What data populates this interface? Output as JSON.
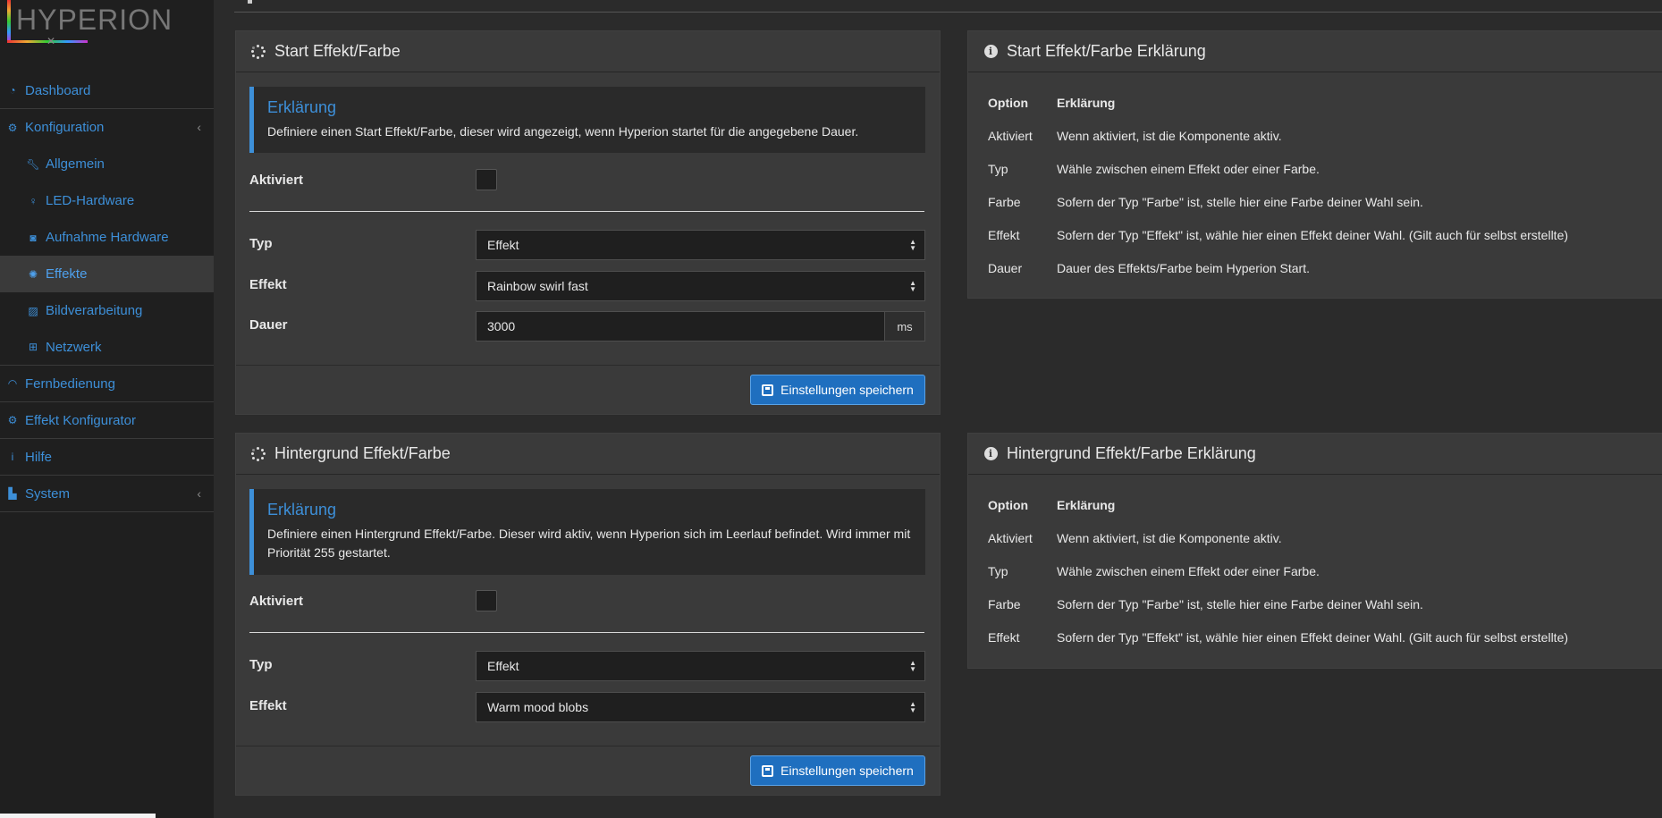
{
  "app": {
    "logo_text": "HYPERION"
  },
  "sidebar": {
    "items": [
      {
        "label": "Dashboard",
        "icon": "dashboard-icon"
      },
      {
        "label": "Konfiguration",
        "icon": "gear-icon",
        "expanded": true
      },
      {
        "label": "Allgemein",
        "icon": "wrench-icon"
      },
      {
        "label": "LED-Hardware",
        "icon": "lightbulb-icon"
      },
      {
        "label": "Aufnahme Hardware",
        "icon": "camera-icon"
      },
      {
        "label": "Effekte",
        "icon": "spinner-icon",
        "active": true
      },
      {
        "label": "Bildverarbeitung",
        "icon": "image-icon"
      },
      {
        "label": "Netzwerk",
        "icon": "network-icon"
      },
      {
        "label": "Fernbedienung",
        "icon": "wifi-icon"
      },
      {
        "label": "Effekt Konfigurator",
        "icon": "gears-icon"
      },
      {
        "label": "Hilfe",
        "icon": "info-icon"
      },
      {
        "label": "System",
        "icon": "chart-icon"
      }
    ]
  },
  "start_panel": {
    "title": "Start Effekt/Farbe",
    "callout_title": "Erklärung",
    "callout_text": "Definiere einen Start Effekt/Farbe, dieser wird angezeigt, wenn Hyperion startet für die angegebene Dauer.",
    "aktiviert_label": "Aktiviert",
    "aktiviert_checked": false,
    "typ_label": "Typ",
    "typ_value": "Effekt",
    "effekt_label": "Effekt",
    "effekt_value": "Rainbow swirl fast",
    "dauer_label": "Dauer",
    "dauer_value": "3000",
    "dauer_unit": "ms",
    "save_label": "Einstellungen speichern"
  },
  "start_explain": {
    "title": "Start Effekt/Farbe Erklärung",
    "header": {
      "option": "Option",
      "explanation": "Erklärung"
    },
    "rows": [
      {
        "option": "Aktiviert",
        "text": "Wenn aktiviert, ist die Komponente aktiv."
      },
      {
        "option": "Typ",
        "text": "Wähle zwischen einem Effekt oder einer Farbe."
      },
      {
        "option": "Farbe",
        "text": "Sofern der Typ \"Farbe\" ist, stelle hier eine Farbe deiner Wahl sein."
      },
      {
        "option": "Effekt",
        "text": "Sofern der Typ \"Effekt\" ist, wähle hier einen Effekt deiner Wahl. (Gilt auch für selbst erstellte)"
      },
      {
        "option": "Dauer",
        "text": "Dauer des Effekts/Farbe beim Hyperion Start."
      }
    ]
  },
  "bg_panel": {
    "title": "Hintergrund Effekt/Farbe",
    "callout_title": "Erklärung",
    "callout_text": "Definiere einen Hintergrund Effekt/Farbe. Dieser wird aktiv, wenn Hyperion sich im Leerlauf befindet. Wird immer mit Priorität 255 gestartet.",
    "aktiviert_label": "Aktiviert",
    "aktiviert_checked": false,
    "typ_label": "Typ",
    "typ_value": "Effekt",
    "effekt_label": "Effekt",
    "effekt_value": "Warm mood blobs",
    "save_label": "Einstellungen speichern"
  },
  "bg_explain": {
    "title": "Hintergrund Effekt/Farbe Erklärung",
    "header": {
      "option": "Option",
      "explanation": "Erklärung"
    },
    "rows": [
      {
        "option": "Aktiviert",
        "text": "Wenn aktiviert, ist die Komponente aktiv."
      },
      {
        "option": "Typ",
        "text": "Wähle zwischen einem Effekt oder einer Farbe."
      },
      {
        "option": "Farbe",
        "text": "Sofern der Typ \"Farbe\" ist, stelle hier eine Farbe deiner Wahl sein."
      },
      {
        "option": "Effekt",
        "text": "Sofern der Typ \"Effekt\" ist, wähle hier einen Effekt deiner Wahl. (Gilt auch für selbst erstellte)"
      }
    ]
  },
  "colors": {
    "accent": "#3d8fd8",
    "button": "#1f6fbf",
    "panel": "#3a3a3a",
    "background": "#2b2b2b",
    "sidebar": "#1f1f1f"
  }
}
